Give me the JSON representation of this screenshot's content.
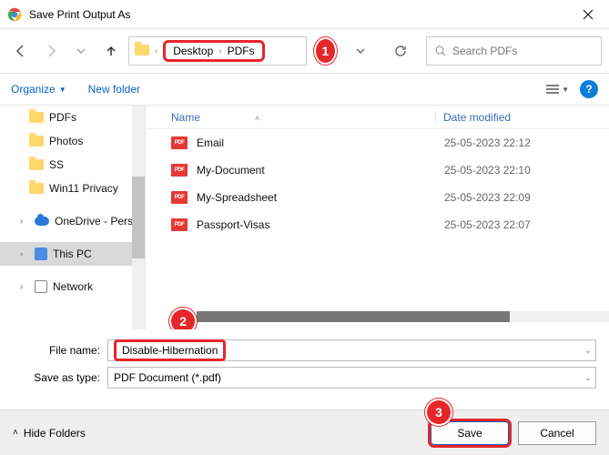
{
  "window": {
    "title": "Save Print Output As"
  },
  "breadcrumb": {
    "part1": "Desktop",
    "part2": "PDFs",
    "sep": "›"
  },
  "search": {
    "placeholder": "Search PDFs"
  },
  "toolbar": {
    "organize": "Organize",
    "newfolder": "New folder"
  },
  "sidebar": {
    "items": [
      {
        "label": "PDFs",
        "type": "folder"
      },
      {
        "label": "Photos",
        "type": "folder"
      },
      {
        "label": "SS",
        "type": "folder"
      },
      {
        "label": "Win11 Privacy",
        "type": "folder"
      }
    ],
    "drives": [
      {
        "label": "OneDrive - Perso",
        "type": "cloud"
      },
      {
        "label": "This PC",
        "type": "pc",
        "selected": true
      },
      {
        "label": "Network",
        "type": "net"
      }
    ]
  },
  "columns": {
    "name": "Name",
    "date": "Date modified"
  },
  "files": [
    {
      "name": "Email",
      "date": "25-05-2023 22:12"
    },
    {
      "name": "My-Document",
      "date": "25-05-2023 22:10"
    },
    {
      "name": "My-Spreadsheet",
      "date": "25-05-2023 22:09"
    },
    {
      "name": "Passport-Visas",
      "date": "25-05-2023 22:07"
    }
  ],
  "form": {
    "filename_label": "File name:",
    "filename_value": "Disable-Hibernation",
    "type_label": "Save as type:",
    "type_value": "PDF Document (*.pdf)"
  },
  "footer": {
    "hide": "Hide Folders",
    "save": "Save",
    "cancel": "Cancel"
  },
  "callouts": {
    "one": "1",
    "two": "2",
    "three": "3"
  }
}
